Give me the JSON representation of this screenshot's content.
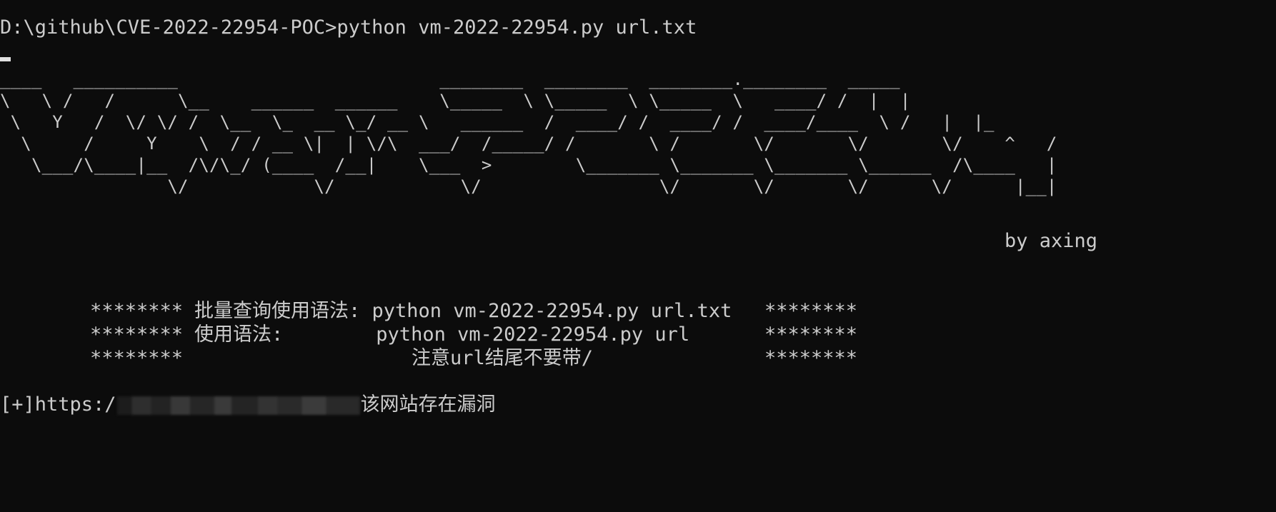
{
  "terminal": {
    "prompt_line": "D:\\github\\CVE-2022-22954-POC>python vm-2022-22954.py url.txt",
    "banner_art": "____   __________                         ________  ________  ________.________  _____  \n\\   \\ /   /      \\__    ______  ______    \\_____  \\ \\_____  \\ \\_____  \\   ____/ /  |  | \n \\   Y   /  \\/ \\/ /  \\__  \\_  __ \\_/ __ \\   ______  /  ____/ /  ____/ /  ____/____  \\ /   |  |_\n  \\     /     Y    \\  / / __ \\|  | \\/\\  ___/  /_____/ /       \\ /       \\/       \\/       \\/    ^   /\n   \\___/\\____|__  /\\/\\_/ (____  /__|    \\___  >        \\_______ \\_______ \\_______ \\______  /\\____   | \n                \\/            \\/            \\/                 \\/       \\/       \\/      \\/      |__| ",
    "author": "by axing",
    "usage": [
      {
        "left": "********",
        "text": "批量查询使用语法: python vm-2022-22954.py url.txt",
        "right": "********"
      },
      {
        "left": "********",
        "text": "使用语法:        python vm-2022-22954.py url",
        "right": "********"
      },
      {
        "left": "********",
        "text": "注意url结尾不要带/",
        "right": "********"
      }
    ],
    "result": {
      "prefix": "[+]https:/",
      "suffix": "该网站存在漏洞"
    }
  }
}
